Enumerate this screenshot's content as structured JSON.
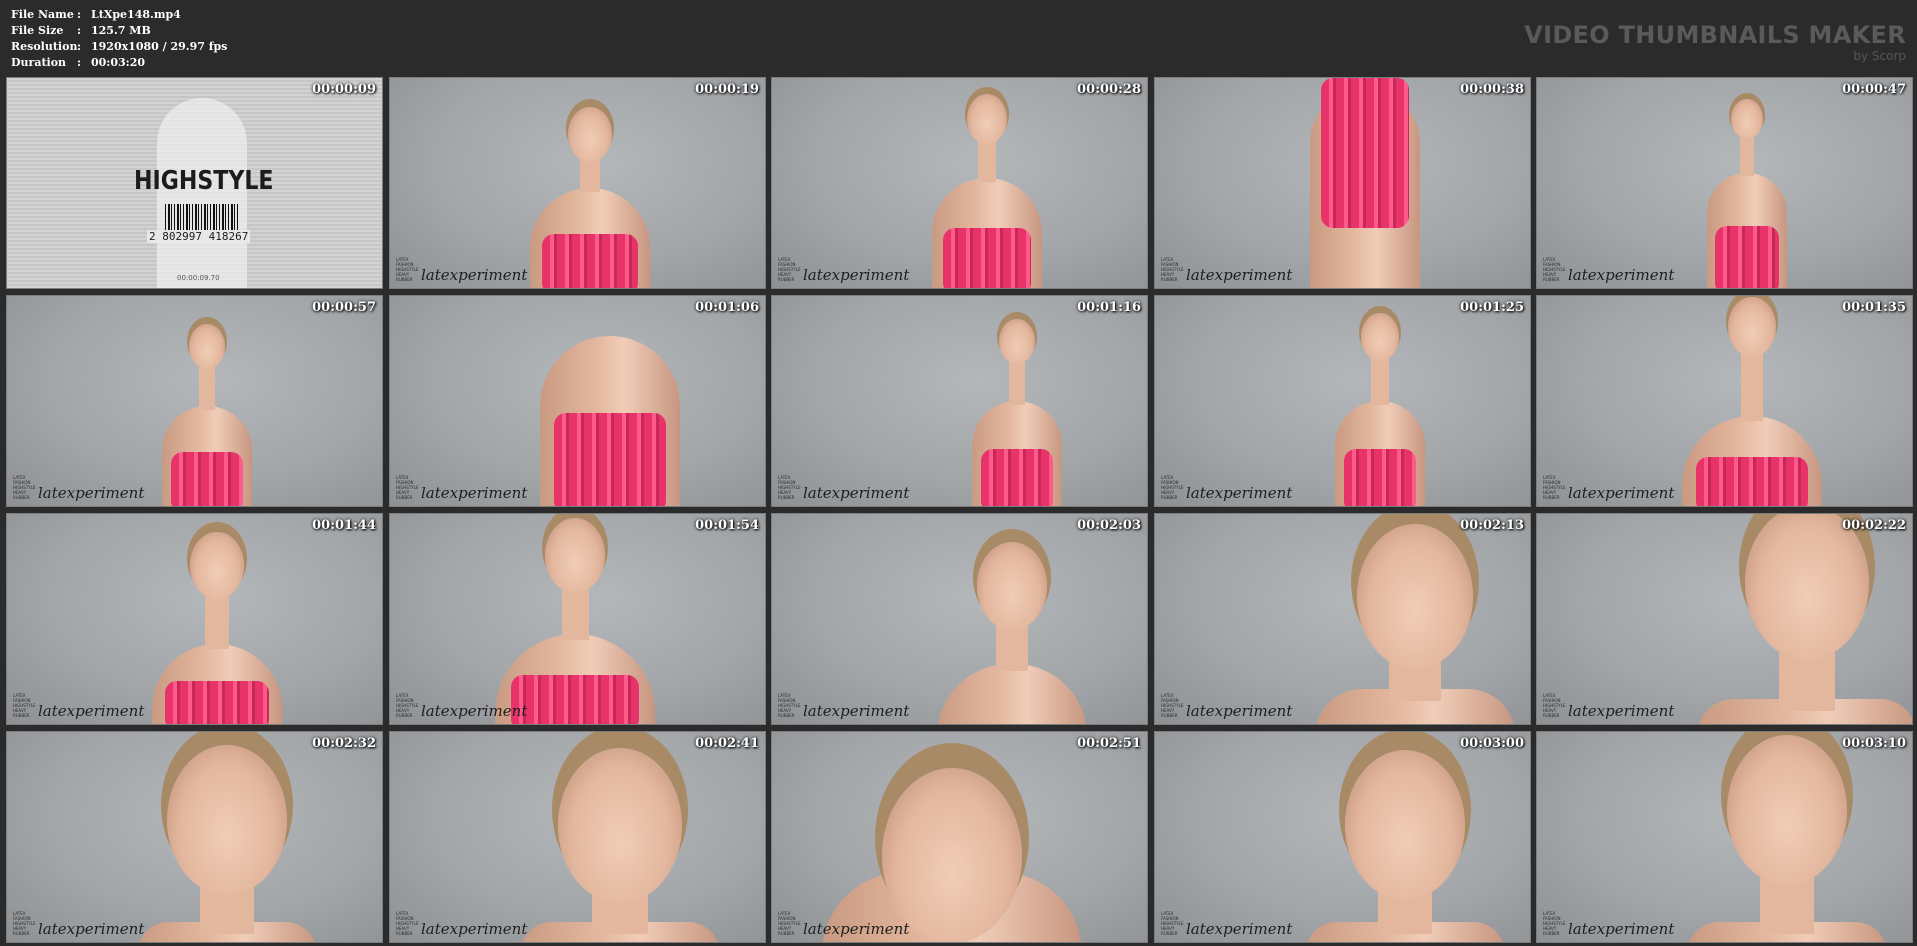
{
  "meta": {
    "file_name_label": "File Name",
    "file_name": "LtXpe148.mp4",
    "file_size_label": "File Size",
    "file_size": "125.7 MB",
    "resolution_label": "Resolution",
    "resolution": "1920x1080 / 29.97 fps",
    "duration_label": "Duration",
    "duration": "00:03:20",
    "separator": ":"
  },
  "brand": {
    "title": "VIDEO THUMBNAILS MAKER",
    "subtitle": "by Scorp"
  },
  "intro": {
    "title": "HIGHSTYLE",
    "barcode_number": "2 802997 418267",
    "timecode": "00:00:09.70"
  },
  "logo": {
    "small_text": "LATEX FASHION HIGHSTYLE HEAVY RUBBER",
    "main_text": "latexperiment"
  },
  "thumbnails": [
    {
      "timestamp": "00:00:09"
    },
    {
      "timestamp": "00:00:19"
    },
    {
      "timestamp": "00:00:28"
    },
    {
      "timestamp": "00:00:38"
    },
    {
      "timestamp": "00:00:47"
    },
    {
      "timestamp": "00:00:57"
    },
    {
      "timestamp": "00:01:06"
    },
    {
      "timestamp": "00:01:16"
    },
    {
      "timestamp": "00:01:25"
    },
    {
      "timestamp": "00:01:35"
    },
    {
      "timestamp": "00:01:44"
    },
    {
      "timestamp": "00:01:54"
    },
    {
      "timestamp": "00:02:03"
    },
    {
      "timestamp": "00:02:13"
    },
    {
      "timestamp": "00:02:22"
    },
    {
      "timestamp": "00:02:32"
    },
    {
      "timestamp": "00:02:41"
    },
    {
      "timestamp": "00:02:51"
    },
    {
      "timestamp": "00:03:00"
    },
    {
      "timestamp": "00:03:10"
    }
  ],
  "colors": {
    "background": "#2b2b2b",
    "backdrop": "#a3a6a9",
    "dress": "#e8336a",
    "skin": "#e3b79e"
  }
}
